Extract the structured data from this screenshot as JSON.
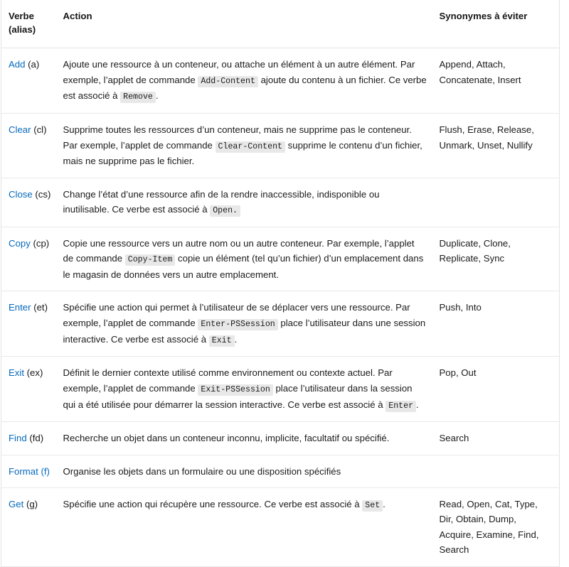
{
  "table": {
    "headers": {
      "verb": "Verbe (alias)",
      "verb_line1": "Verbe",
      "verb_line2": "(alias)",
      "action": "Action",
      "synonyms": "Synonymes à éviter"
    },
    "link_color": "#0669bc",
    "border_color": "#e3e3e3",
    "code_background": "#e8e8e8",
    "rows": [
      {
        "verb": "Add",
        "alias": "(a)",
        "alias_is_link": false,
        "action_parts": [
          {
            "type": "text",
            "value": "Ajoute une ressource à un conteneur, ou attache un élément à un autre élément. Par exemple, l’applet de commande "
          },
          {
            "type": "code",
            "value": "Add-Content"
          },
          {
            "type": "text",
            "value": " ajoute du contenu à un fichier. Ce verbe est associé à "
          },
          {
            "type": "code",
            "value": "Remove"
          },
          {
            "type": "text",
            "value": "."
          }
        ],
        "synonyms": "Append, Attach, Concatenate, Insert"
      },
      {
        "verb": "Clear",
        "alias": "(cl)",
        "alias_is_link": false,
        "action_parts": [
          {
            "type": "text",
            "value": "Supprime toutes les ressources d’un conteneur, mais ne supprime pas le conteneur. Par exemple, l’applet de commande "
          },
          {
            "type": "code",
            "value": "Clear-Content"
          },
          {
            "type": "text",
            "value": " supprime le contenu d’un fichier, mais ne supprime pas le fichier."
          }
        ],
        "synonyms": "Flush, Erase, Release, Unmark, Unset, Nullify"
      },
      {
        "verb": "Close",
        "alias": "(cs)",
        "alias_is_link": false,
        "action_parts": [
          {
            "type": "text",
            "value": "Change l’état d’une ressource afin de la rendre inaccessible, indisponible ou inutilisable. Ce verbe est associé à "
          },
          {
            "type": "code",
            "value": "Open."
          }
        ],
        "synonyms": ""
      },
      {
        "verb": "Copy",
        "alias": "(cp)",
        "alias_is_link": false,
        "action_parts": [
          {
            "type": "text",
            "value": "Copie une ressource vers un autre nom ou un autre conteneur. Par exemple, l’applet de commande "
          },
          {
            "type": "code",
            "value": "Copy-Item"
          },
          {
            "type": "text",
            "value": " copie un élément (tel qu’un fichier) d’un emplacement dans le magasin de données vers un autre emplacement."
          }
        ],
        "synonyms": "Duplicate, Clone, Replicate, Sync"
      },
      {
        "verb": "Enter",
        "alias": "(et)",
        "alias_is_link": false,
        "action_parts": [
          {
            "type": "text",
            "value": "Spécifie une action qui permet à l’utilisateur de se déplacer vers une ressource. Par exemple, l’applet de commande "
          },
          {
            "type": "code",
            "value": "Enter-PSSession"
          },
          {
            "type": "text",
            "value": " place l’utilisateur dans une session interactive. Ce verbe est associé à "
          },
          {
            "type": "code",
            "value": "Exit"
          },
          {
            "type": "text",
            "value": "."
          }
        ],
        "synonyms": "Push, Into"
      },
      {
        "verb": "Exit",
        "alias": "(ex)",
        "alias_is_link": false,
        "action_parts": [
          {
            "type": "text",
            "value": "Définit le dernier contexte utilisé comme environnement ou contexte actuel. Par exemple, l’applet de commande "
          },
          {
            "type": "code",
            "value": "Exit-PSSession"
          },
          {
            "type": "text",
            "value": " place l’utilisateur dans la session qui a été utilisée pour démarrer la session interactive. Ce verbe est associé à "
          },
          {
            "type": "code",
            "value": "Enter"
          },
          {
            "type": "text",
            "value": "."
          }
        ],
        "synonyms": "Pop, Out"
      },
      {
        "verb": "Find",
        "alias": "(fd)",
        "alias_is_link": false,
        "action_parts": [
          {
            "type": "text",
            "value": "Recherche un objet dans un conteneur inconnu, implicite, facultatif ou spécifié."
          }
        ],
        "synonyms": "Search"
      },
      {
        "verb": "Format",
        "alias": "(f)",
        "alias_is_link": true,
        "action_parts": [
          {
            "type": "text",
            "value": "Organise les objets dans un formulaire ou une disposition spécifiés"
          }
        ],
        "synonyms": ""
      },
      {
        "verb": "Get",
        "alias": "(g)",
        "alias_is_link": false,
        "action_parts": [
          {
            "type": "text",
            "value": "Spécifie une action qui récupère une ressource. Ce verbe est associé à "
          },
          {
            "type": "code",
            "value": "Set"
          },
          {
            "type": "text",
            "value": "."
          }
        ],
        "synonyms": "Read, Open, Cat, Type, Dir, Obtain, Dump, Acquire, Examine, Find, Search"
      }
    ]
  }
}
